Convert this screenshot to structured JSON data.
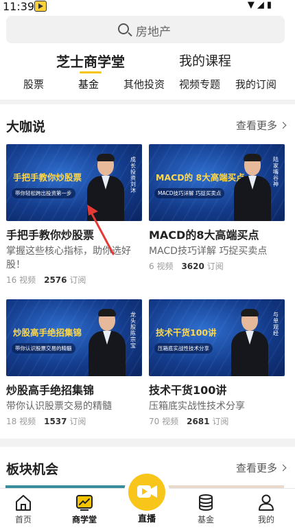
{
  "status_bar": {
    "time": "11:39",
    "icons_text": "▼◢▮"
  },
  "search": {
    "placeholder": "房地产"
  },
  "top_tabs": [
    {
      "label": "芝士商学堂",
      "active": true
    },
    {
      "label": "我的课程",
      "active": false
    }
  ],
  "sub_tabs": [
    {
      "label": "股票"
    },
    {
      "label": "基金"
    },
    {
      "label": "其他投资"
    },
    {
      "label": "视频专题"
    },
    {
      "label": "我的订阅"
    }
  ],
  "section1": {
    "title": "大咖说",
    "more": "查看更多",
    "cards": [
      {
        "thumb_title": "手把手教你炒股票",
        "thumb_sub": "带你轻松跨出投资第一步",
        "thumb_vtext": "成长投资刘沐",
        "title": "手把手教你炒股票",
        "desc": "掌握这些核心指标，助你选好股！",
        "videos": "16 视频",
        "subs_num": "2576",
        "subs_label": "订阅"
      },
      {
        "thumb_title": "MACD的 8大高端买点",
        "thumb_sub": "MACD技巧详解 巧捉买卖点",
        "thumb_vtext": "陆家嘴谷神",
        "title": "MACD的8大高端买点",
        "desc": "MACD技巧详解 巧捉买卖点",
        "videos": "6 视频",
        "subs_num": "3620",
        "subs_label": "订阅"
      },
      {
        "thumb_title": "炒股高手绝招集锦",
        "thumb_sub": "带你认识股票交易的精髓",
        "thumb_vtext": "龙头股陈宗宝",
        "title": "炒股高手绝招集锦",
        "desc": "带你认识股票交易的精髓",
        "videos": "18 视频",
        "subs_num": "1537",
        "subs_label": "订阅"
      },
      {
        "thumb_title": "技术干货100讲",
        "thumb_sub": "压箱底实战性技术分享",
        "thumb_vtext": "与单观经",
        "title": "技术干货100讲",
        "desc": "压箱底实战性技术分享",
        "videos": "70 视频",
        "subs_num": "2681",
        "subs_label": "订阅"
      }
    ]
  },
  "section2": {
    "title": "板块机会",
    "more": "查看更多"
  },
  "bottom_nav": [
    {
      "label": "首页"
    },
    {
      "label": "商学堂",
      "active": true
    },
    {
      "label": "直播"
    },
    {
      "label": "基金"
    },
    {
      "label": "我的"
    }
  ],
  "colors": {
    "accent": "#f5c400",
    "live": "#f8c51b",
    "arrow": "#e53935"
  }
}
